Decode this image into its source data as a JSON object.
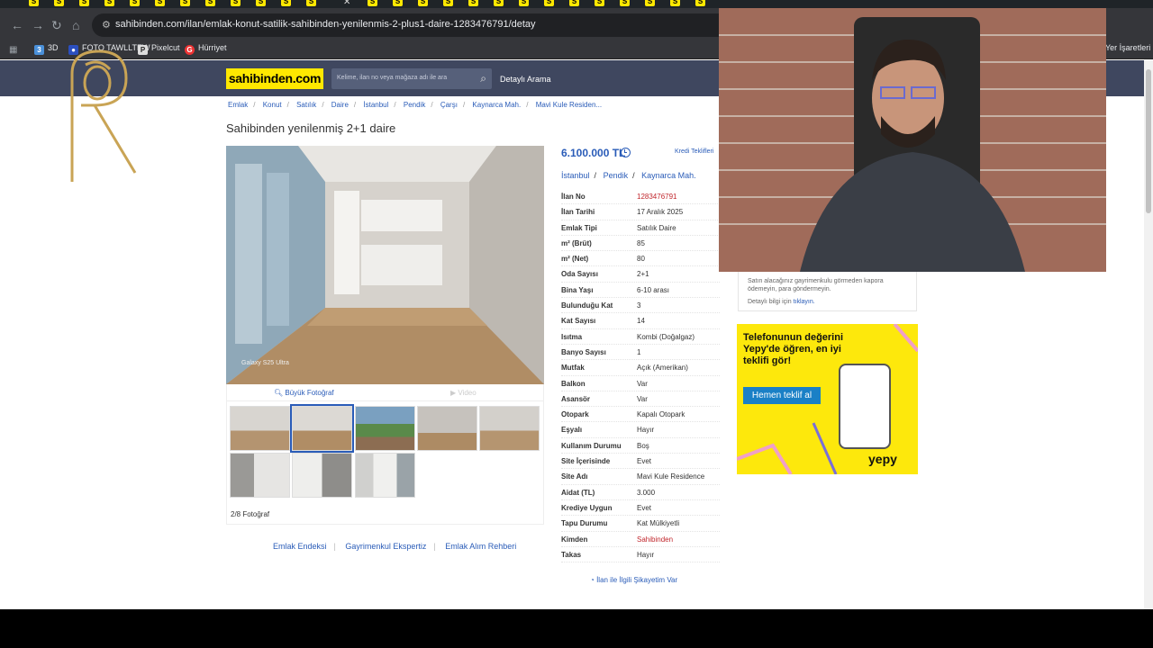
{
  "browser": {
    "url": "sahibinden.com/ilan/emlak-konut-satilik-sahibinden-yenilenmis-2-plus1-daire-1283476791/detay",
    "bookmarks": [
      "3D",
      "FOTO TAWLLTEW",
      "Pixelcut",
      "Hürriyet"
    ],
    "bookmarks_right": "Yer İşaretleri"
  },
  "site": {
    "logo": "sahibinden.com",
    "search_placeholder": "Kelime, ilan no veya mağaza adı ile ara",
    "detailed_search": "Detaylı Arama"
  },
  "breadcrumb": [
    "Emlak",
    "Konut",
    "Satılık",
    "Daire",
    "İstanbul",
    "Pendik",
    "Çarşı",
    "Kaynarca Mah.",
    "Mavi Kule Residen..."
  ],
  "listing": {
    "title": "Sahibinden yenilenmiş 2+1 daire",
    "price": "6.100.000 TL",
    "credit_offers": "Kredi Teklifleri",
    "location": [
      "İstanbul",
      "Pendik",
      "Kaynarca Mah."
    ],
    "photo_watermark": "Galaxy S25 Ultra",
    "big_photo": "Büyük Fotoğraf",
    "video": "Video",
    "photo_count": "2/8 Fotoğraf",
    "details": [
      {
        "label": "İlan No",
        "value": "1283476791",
        "accent": true
      },
      {
        "label": "İlan Tarihi",
        "value": "17 Aralık 2025"
      },
      {
        "label": "Emlak Tipi",
        "value": "Satılık Daire"
      },
      {
        "label": "m² (Brüt)",
        "value": "85"
      },
      {
        "label": "m² (Net)",
        "value": "80"
      },
      {
        "label": "Oda Sayısı",
        "value": "2+1"
      },
      {
        "label": "Bina Yaşı",
        "value": "6-10 arası"
      },
      {
        "label": "Bulunduğu Kat",
        "value": "3"
      },
      {
        "label": "Kat Sayısı",
        "value": "14"
      },
      {
        "label": "Isıtma",
        "value": "Kombi (Doğalgaz)"
      },
      {
        "label": "Banyo Sayısı",
        "value": "1"
      },
      {
        "label": "Mutfak",
        "value": "Açık (Amerikan)"
      },
      {
        "label": "Balkon",
        "value": "Var"
      },
      {
        "label": "Asansör",
        "value": "Var"
      },
      {
        "label": "Otopark",
        "value": "Kapalı Otopark"
      },
      {
        "label": "Eşyalı",
        "value": "Hayır"
      },
      {
        "label": "Kullanım Durumu",
        "value": "Boş"
      },
      {
        "label": "Site İçerisinde",
        "value": "Evet"
      },
      {
        "label": "Site Adı",
        "value": "Mavi Kule Residence"
      },
      {
        "label": "Aidat (TL)",
        "value": "3.000"
      },
      {
        "label": "Krediye Uygun",
        "value": "Evet"
      },
      {
        "label": "Tapu Durumu",
        "value": "Kat Mülkiyetli"
      },
      {
        "label": "Kimden",
        "value": "Sahibinden",
        "accent": true
      },
      {
        "label": "Takas",
        "value": "Hayır"
      }
    ],
    "complaint": "İlan ile İlgili Şikayetim Var"
  },
  "bottom_links": [
    "Emlak Endeksi",
    "Gayrimenkul Ekspertiz",
    "Emlak Alım Rehberi"
  ],
  "warning": {
    "text": "Satın alacağınız gayrimenkulu görmeden kapora ödemeyin, para göndermeyin.",
    "more_prefix": "Detaylı bilgi için",
    "more_link": "tıklayın."
  },
  "ad": {
    "headline": "Telefonunun değerini Yepy'de öğren, en iyi teklifi gör!",
    "button": "Hemen teklif al",
    "brand": "yepy"
  },
  "colors": {
    "brand_yellow": "#ffe800",
    "header_navy": "#3f475f",
    "link_blue": "#2a5cb8",
    "accent_red": "#c1272d"
  }
}
